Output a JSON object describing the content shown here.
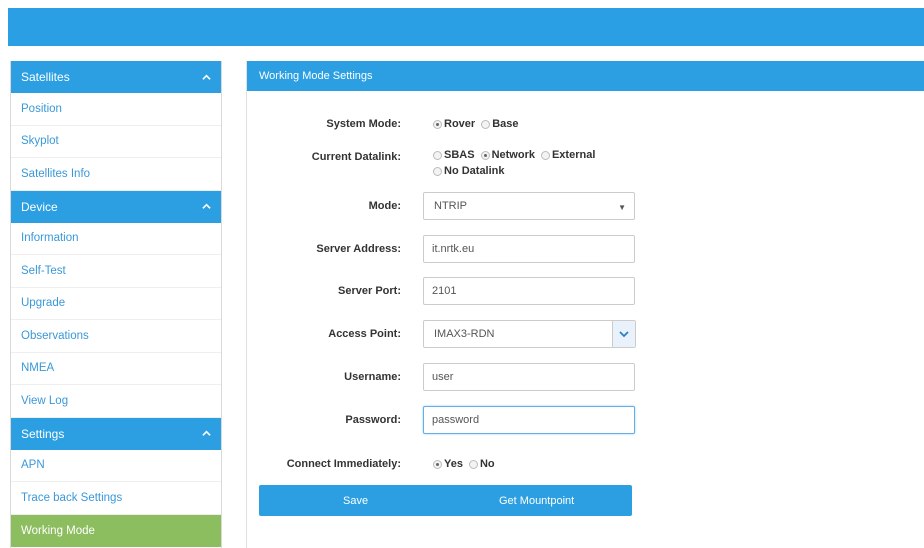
{
  "sidebar": {
    "sections": [
      {
        "title": "Satellites",
        "items": [
          "Position",
          "Skyplot",
          "Satellites Info"
        ]
      },
      {
        "title": "Device",
        "items": [
          "Information",
          "Self-Test",
          "Upgrade",
          "Observations",
          "NMEA",
          "View Log"
        ]
      },
      {
        "title": "Settings",
        "items": [
          "APN",
          "Trace back Settings",
          "Working Mode"
        ]
      }
    ],
    "active_item": "Working Mode"
  },
  "panel": {
    "title": "Working Mode Settings",
    "system_mode": {
      "label": "System Mode:",
      "options": [
        "Rover",
        "Base"
      ],
      "selected": "Rover"
    },
    "current_datalink": {
      "label": "Current Datalink:",
      "options": [
        "SBAS",
        "Network",
        "External",
        "No Datalink"
      ],
      "selected": "Network"
    },
    "mode": {
      "label": "Mode:",
      "value": "NTRIP"
    },
    "server_address": {
      "label": "Server Address:",
      "value": "it.nrtk.eu"
    },
    "server_port": {
      "label": "Server Port:",
      "value": "2101"
    },
    "access_point": {
      "label": "Access Point:",
      "value": "IMAX3-RDN"
    },
    "username": {
      "label": "Username:",
      "value": "user"
    },
    "password": {
      "label": "Password:",
      "value": "password"
    },
    "connect_immediately": {
      "label": "Connect Immediately:",
      "options": [
        "Yes",
        "No"
      ],
      "selected": "Yes"
    },
    "buttons": {
      "save": "Save",
      "get_mountpoint": "Get Mountpoint"
    }
  },
  "colors": {
    "accent": "#2b9fe2",
    "active_nav": "#8cbd5e",
    "link": "#3a98d8"
  }
}
